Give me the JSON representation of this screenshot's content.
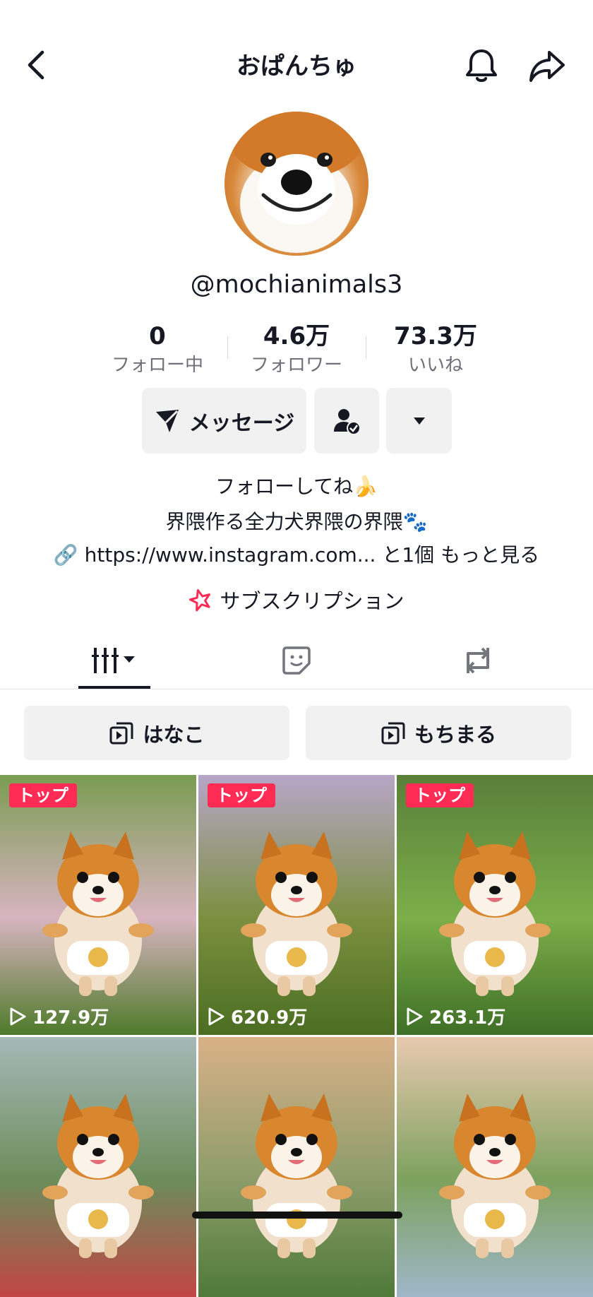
{
  "header": {
    "title": "おぱんちゅ",
    "back_icon": "chevron-left-icon",
    "bell_icon": "bell-icon",
    "share_icon": "share-arrow-icon"
  },
  "profile": {
    "username": "@mochianimals3",
    "stats": [
      {
        "value": "0",
        "label": "フォロー中"
      },
      {
        "value": "4.6万",
        "label": "フォロワー"
      },
      {
        "value": "73.3万",
        "label": "いいね"
      }
    ],
    "message_button": "メッセージ",
    "bio_line1": "フォローしてね🍌",
    "bio_line2": "界隈作る全力犬界隈の界隈🐾",
    "link_text": "🔗 https://www.instagram.com...  と1個  もっと見る",
    "subscription": "サブスクリプション"
  },
  "playlists": [
    {
      "label": "はなこ"
    },
    {
      "label": "もちまる"
    }
  ],
  "videos": [
    {
      "badge": "トップ",
      "views": "127.9万",
      "colors": [
        "#7a9c52",
        "#d8b4c0",
        "#4e7a2a"
      ]
    },
    {
      "badge": "トップ",
      "views": "620.9万",
      "colors": [
        "#b7a6c8",
        "#7c8f40",
        "#4b6e22"
      ]
    },
    {
      "badge": "トップ",
      "views": "263.1万",
      "colors": [
        "#5a7f3a",
        "#7cae4a",
        "#3f6f26"
      ]
    },
    {
      "badge": "",
      "views": "",
      "colors": [
        "#a6b8b8",
        "#6c8d5a",
        "#c24545"
      ]
    },
    {
      "badge": "",
      "views": "",
      "colors": [
        "#d9b188",
        "#8c9c6a",
        "#4f7a38"
      ]
    },
    {
      "badge": "",
      "views": "",
      "colors": [
        "#e8c9b0",
        "#7da15e",
        "#9fb6c9"
      ]
    }
  ],
  "colors": {
    "accent": "#fe2c55",
    "text": "#161823",
    "muted": "#6f7079",
    "button_bg": "#f1f1f2"
  }
}
